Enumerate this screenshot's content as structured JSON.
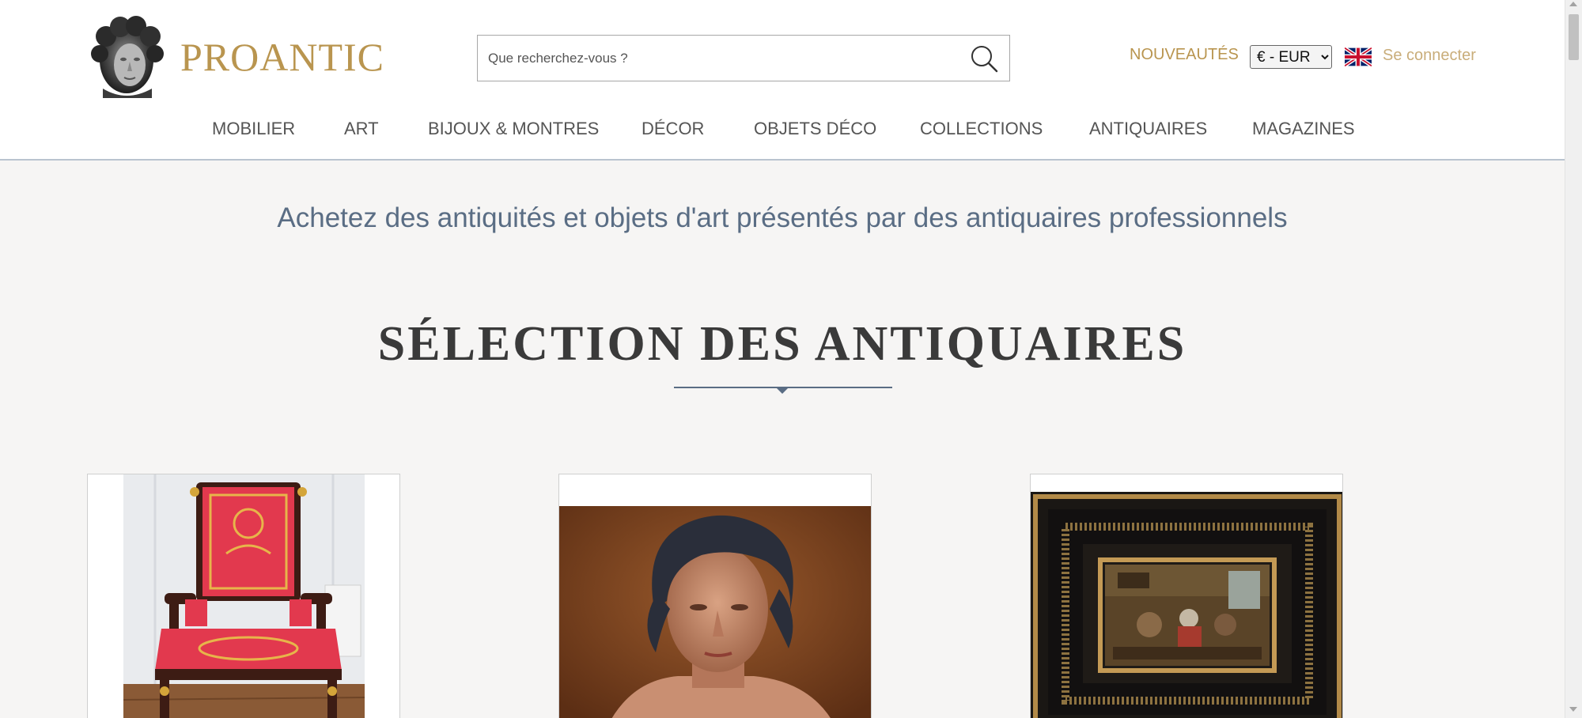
{
  "header": {
    "logo_text": "PROANTIC",
    "logo_icon": "sculpted-head-logo",
    "search": {
      "placeholder": "Que recherchez-vous ?",
      "value": "",
      "icon": "search-icon"
    },
    "nouveautes_label": "NOUVEAUTÉS",
    "currency": {
      "selected": "€ - EUR",
      "options": [
        "€ - EUR"
      ]
    },
    "language_flag": "uk-flag-icon",
    "login_label": "Se connecter"
  },
  "nav": {
    "items": [
      {
        "label": "MOBILIER"
      },
      {
        "label": "ART"
      },
      {
        "label": "BIJOUX & MONTRES"
      },
      {
        "label": "DÉCOR"
      },
      {
        "label": "OBJETS DÉCO"
      },
      {
        "label": "COLLECTIONS"
      },
      {
        "label": "ANTIQUAIRES"
      },
      {
        "label": "MAGAZINES"
      }
    ]
  },
  "main": {
    "tagline": "Achetez des antiquités et objets d'art présentés par des antiquaires professionnels",
    "section_title": "SÉLECTION DES ANTIQUAIRES",
    "cards": [
      {
        "image": "empire-armchair-red-upholstery"
      },
      {
        "image": "portrait-woman-dark-hair-painting"
      },
      {
        "image": "framed-interior-scene-painting"
      }
    ]
  },
  "colors": {
    "brand_gold": "#b9954f",
    "login_gold": "#c9ad7a",
    "tagline_blue": "#5a6d84",
    "page_background": "#f6f5f4"
  }
}
